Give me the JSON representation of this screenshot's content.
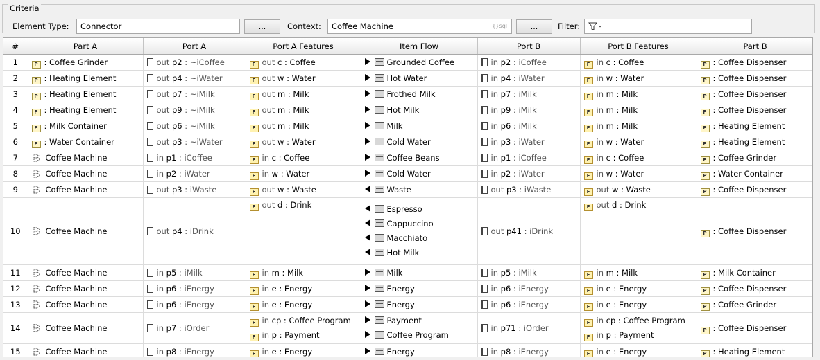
{
  "criteria": {
    "legend": "Criteria",
    "element_type_label": "Element Type:",
    "element_type_value": "Connector",
    "browse_label": "...",
    "context_label": "Context:",
    "context_value": "Coffee Machine",
    "oql_hint": "{}sql",
    "filter_label": "Filter:",
    "filter_icon": "filter-icon"
  },
  "columns": [
    "#",
    "Part A",
    "Port A",
    "Port A Features",
    "Item Flow",
    "Port B",
    "Port B Features",
    "Part B"
  ],
  "rows": [
    {
      "num": "1",
      "partA": {
        "icon": "part",
        "text": ": Coffee Grinder"
      },
      "portA": {
        "dir": "out",
        "name": "p2",
        "type": ": ~iCoffee"
      },
      "featA": [
        {
          "dir": "out",
          "name": "c",
          "type": ": Coffee"
        }
      ],
      "flows": [
        {
          "arrow": "right",
          "text": "Grounded Coffee"
        }
      ],
      "portB": {
        "dir": "in",
        "name": "p2",
        "type": ": iCoffee"
      },
      "featB": [
        {
          "dir": "in",
          "name": "c",
          "type": ": Coffee"
        }
      ],
      "partB": ": Coffee Dispenser"
    },
    {
      "num": "2",
      "partA": {
        "icon": "part",
        "text": ": Heating Element"
      },
      "portA": {
        "dir": "out",
        "name": "p4",
        "type": ": ~iWater"
      },
      "featA": [
        {
          "dir": "out",
          "name": "w",
          "type": ": Water"
        }
      ],
      "flows": [
        {
          "arrow": "right",
          "text": "Hot Water"
        }
      ],
      "portB": {
        "dir": "in",
        "name": "p4",
        "type": ": iWater"
      },
      "featB": [
        {
          "dir": "in",
          "name": "w",
          "type": ": Water"
        }
      ],
      "partB": ": Coffee Dispenser"
    },
    {
      "num": "3",
      "partA": {
        "icon": "part",
        "text": ": Heating Element"
      },
      "portA": {
        "dir": "out",
        "name": "p7",
        "type": ": ~iMilk"
      },
      "featA": [
        {
          "dir": "out",
          "name": "m",
          "type": ": Milk"
        }
      ],
      "flows": [
        {
          "arrow": "right",
          "text": "Frothed Milk"
        }
      ],
      "portB": {
        "dir": "in",
        "name": "p7",
        "type": ": iMilk"
      },
      "featB": [
        {
          "dir": "in",
          "name": "m",
          "type": ": Milk"
        }
      ],
      "partB": ": Coffee Dispenser"
    },
    {
      "num": "4",
      "partA": {
        "icon": "part",
        "text": ": Heating Element"
      },
      "portA": {
        "dir": "out",
        "name": "p9",
        "type": ": ~iMilk"
      },
      "featA": [
        {
          "dir": "out",
          "name": "m",
          "type": ": Milk"
        }
      ],
      "flows": [
        {
          "arrow": "right",
          "text": "Hot Milk"
        }
      ],
      "portB": {
        "dir": "in",
        "name": "p9",
        "type": ": iMilk"
      },
      "featB": [
        {
          "dir": "in",
          "name": "m",
          "type": ": Milk"
        }
      ],
      "partB": ": Coffee Dispenser"
    },
    {
      "num": "5",
      "partA": {
        "icon": "part",
        "text": ": Milk Container"
      },
      "portA": {
        "dir": "out",
        "name": "p6",
        "type": ": ~iMilk"
      },
      "featA": [
        {
          "dir": "out",
          "name": "m",
          "type": ": Milk"
        }
      ],
      "flows": [
        {
          "arrow": "right",
          "text": "Milk"
        }
      ],
      "portB": {
        "dir": "in",
        "name": "p6",
        "type": ": iMilk"
      },
      "featB": [
        {
          "dir": "in",
          "name": "m",
          "type": ": Milk"
        }
      ],
      "partB": ": Heating Element"
    },
    {
      "num": "6",
      "partA": {
        "icon": "part",
        "text": ": Water Container"
      },
      "portA": {
        "dir": "out",
        "name": "p3",
        "type": ": ~iWater"
      },
      "featA": [
        {
          "dir": "out",
          "name": "w",
          "type": ": Water"
        }
      ],
      "flows": [
        {
          "arrow": "right",
          "text": "Cold Water"
        }
      ],
      "portB": {
        "dir": "in",
        "name": "p3",
        "type": ": iWater"
      },
      "featB": [
        {
          "dir": "in",
          "name": "w",
          "type": ": Water"
        }
      ],
      "partB": ": Heating Element"
    },
    {
      "num": "7",
      "partA": {
        "icon": "block",
        "text": "Coffee Machine"
      },
      "portA": {
        "dir": "in",
        "name": "p1",
        "type": ": iCoffee"
      },
      "featA": [
        {
          "dir": "in",
          "name": "c",
          "type": ": Coffee"
        }
      ],
      "flows": [
        {
          "arrow": "right",
          "text": "Coffee Beans"
        }
      ],
      "portB": {
        "dir": "in",
        "name": "p1",
        "type": ": iCoffee"
      },
      "featB": [
        {
          "dir": "in",
          "name": "c",
          "type": ": Coffee"
        }
      ],
      "partB": ": Coffee Grinder"
    },
    {
      "num": "8",
      "partA": {
        "icon": "block",
        "text": "Coffee Machine"
      },
      "portA": {
        "dir": "in",
        "name": "p2",
        "type": ": iWater"
      },
      "featA": [
        {
          "dir": "in",
          "name": "w",
          "type": ": Water"
        }
      ],
      "flows": [
        {
          "arrow": "right",
          "text": "Cold Water"
        }
      ],
      "portB": {
        "dir": "in",
        "name": "p2",
        "type": ": iWater"
      },
      "featB": [
        {
          "dir": "in",
          "name": "w",
          "type": ": Water"
        }
      ],
      "partB": ": Water Container"
    },
    {
      "num": "9",
      "partA": {
        "icon": "block",
        "text": "Coffee Machine"
      },
      "portA": {
        "dir": "out",
        "name": "p3",
        "type": ": iWaste"
      },
      "featA": [
        {
          "dir": "out",
          "name": "w",
          "type": ": Waste"
        }
      ],
      "flows": [
        {
          "arrow": "left",
          "text": "Waste"
        }
      ],
      "portB": {
        "dir": "out",
        "name": "p3",
        "type": ": iWaste"
      },
      "featB": [
        {
          "dir": "out",
          "name": "w",
          "type": ": Waste"
        }
      ],
      "partB": ": Coffee Dispenser"
    },
    {
      "num": "10",
      "partA": {
        "icon": "block",
        "text": "Coffee Machine"
      },
      "portA": {
        "dir": "out",
        "name": "p4",
        "type": ": iDrink"
      },
      "featA": [
        {
          "dir": "out",
          "name": "d",
          "type": ": Drink"
        }
      ],
      "flows": [
        {
          "arrow": "left",
          "text": "Espresso"
        },
        {
          "arrow": "left",
          "text": "Cappuccino"
        },
        {
          "arrow": "left",
          "text": "Macchiato"
        },
        {
          "arrow": "left",
          "text": "Hot Milk"
        }
      ],
      "portB": {
        "dir": "out",
        "name": "p41",
        "type": ": iDrink"
      },
      "featB": [
        {
          "dir": "out",
          "name": "d",
          "type": ": Drink"
        }
      ],
      "partB": ": Coffee Dispenser",
      "tall": true
    },
    {
      "num": "11",
      "partA": {
        "icon": "block",
        "text": "Coffee Machine"
      },
      "portA": {
        "dir": "in",
        "name": "p5",
        "type": ": iMilk"
      },
      "featA": [
        {
          "dir": "in",
          "name": "m",
          "type": ": Milk"
        }
      ],
      "flows": [
        {
          "arrow": "right",
          "text": "Milk"
        }
      ],
      "portB": {
        "dir": "in",
        "name": "p5",
        "type": ": iMilk"
      },
      "featB": [
        {
          "dir": "in",
          "name": "m",
          "type": ": Milk"
        }
      ],
      "partB": ": Milk Container"
    },
    {
      "num": "12",
      "partA": {
        "icon": "block",
        "text": "Coffee Machine"
      },
      "portA": {
        "dir": "in",
        "name": "p6",
        "type": ": iEnergy"
      },
      "featA": [
        {
          "dir": "in",
          "name": "e",
          "type": ": Energy"
        }
      ],
      "flows": [
        {
          "arrow": "right",
          "text": "Energy"
        }
      ],
      "portB": {
        "dir": "in",
        "name": "p6",
        "type": ": iEnergy"
      },
      "featB": [
        {
          "dir": "in",
          "name": "e",
          "type": ": Energy"
        }
      ],
      "partB": ": Coffee Dispenser"
    },
    {
      "num": "13",
      "partA": {
        "icon": "block",
        "text": "Coffee Machine"
      },
      "portA": {
        "dir": "in",
        "name": "p6",
        "type": ": iEnergy"
      },
      "featA": [
        {
          "dir": "in",
          "name": "e",
          "type": ": Energy"
        }
      ],
      "flows": [
        {
          "arrow": "right",
          "text": "Energy"
        }
      ],
      "portB": {
        "dir": "in",
        "name": "p6",
        "type": ": iEnergy"
      },
      "featB": [
        {
          "dir": "in",
          "name": "e",
          "type": ": Energy"
        }
      ],
      "partB": ": Coffee Grinder"
    },
    {
      "num": "14",
      "partA": {
        "icon": "block",
        "text": "Coffee Machine"
      },
      "portA": {
        "dir": "in",
        "name": "p7",
        "type": ": iOrder"
      },
      "featA": [
        {
          "dir": "in",
          "name": "cp",
          "type": ": Coffee Program"
        },
        {
          "dir": "in",
          "name": "p",
          "type": ": Payment"
        }
      ],
      "flows": [
        {
          "arrow": "right",
          "text": "Payment"
        },
        {
          "arrow": "right",
          "text": "Coffee Program"
        }
      ],
      "portB": {
        "dir": "in",
        "name": "p71",
        "type": ": iOrder"
      },
      "featB": [
        {
          "dir": "in",
          "name": "cp",
          "type": ": Coffee Program"
        },
        {
          "dir": "in",
          "name": "p",
          "type": ": Payment"
        }
      ],
      "partB": ": Coffee Dispenser"
    },
    {
      "num": "15",
      "partA": {
        "icon": "block",
        "text": "Coffee Machine"
      },
      "portA": {
        "dir": "in",
        "name": "p8",
        "type": ": iEnergy"
      },
      "featA": [
        {
          "dir": "in",
          "name": "e",
          "type": ": Energy"
        }
      ],
      "flows": [
        {
          "arrow": "right",
          "text": "Energy"
        }
      ],
      "portB": {
        "dir": "in",
        "name": "p8",
        "type": ": iEnergy"
      },
      "featB": [
        {
          "dir": "in",
          "name": "e",
          "type": ": Energy"
        }
      ],
      "partB": ": Heating Element"
    }
  ],
  "icons": {
    "part_badge": "P",
    "feature_badge": "F"
  }
}
